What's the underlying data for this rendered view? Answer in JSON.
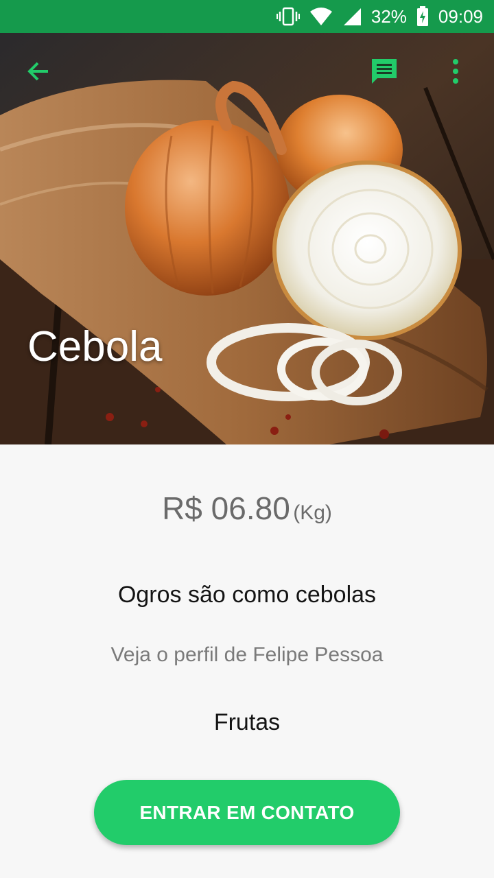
{
  "status_bar": {
    "battery": "32%",
    "time": "09:09"
  },
  "toolbar": {
    "back_icon": "arrow-back-icon",
    "chat_icon": "chat-icon",
    "menu_icon": "more-vert-icon",
    "accent_color": "#22cc6a"
  },
  "product": {
    "title": "Cebola",
    "price": "R$ 06.80",
    "unit": "(Kg)",
    "description": "Ogros são como cebolas",
    "profile_link": "Veja o perfil de Felipe Pessoa",
    "category": "Frutas"
  },
  "actions": {
    "contact_label": "ENTRAR EM CONTATO"
  },
  "colors": {
    "status_bar": "#159a4c",
    "button": "#22cc6a"
  }
}
